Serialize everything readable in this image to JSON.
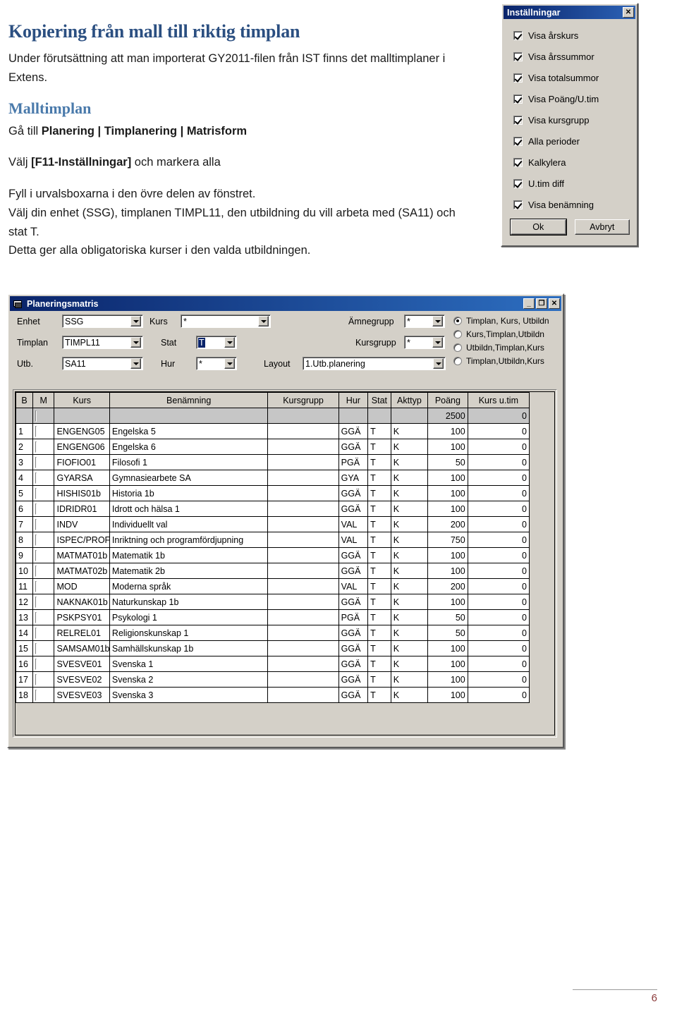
{
  "document": {
    "title": "Kopiering från mall till riktig timplan",
    "intro": "Under förutsättning att man importerat GY2011-filen från IST finns det malltimplaner i Extens.",
    "section_heading": "Malltimplan",
    "line_goto_prefix": "Gå till ",
    "line_goto_bold": "Planering | Timplanering | Matrisform",
    "line_select_prefix": "Välj ",
    "line_select_bold": "[F11-Inställningar]",
    "line_select_suffix": " och markera alla",
    "line_fill": "Fyll i urvalsboxarna i den övre delen av fönstret.",
    "line_choose": "Välj din enhet (SSG), timplanen TIMPL11, den utbildning du vill arbeta med (SA11) och stat T.",
    "line_result": "Detta ger alla obligatoriska kurser i den valda utbildningen.",
    "page_number": "6"
  },
  "settings_dialog": {
    "title": "Inställningar",
    "close_label": "✕",
    "checkboxes": [
      {
        "label": "Visa årskurs",
        "checked": true
      },
      {
        "label": "Visa årssummor",
        "checked": true
      },
      {
        "label": "Visa totalsummor",
        "checked": true
      },
      {
        "label": "Visa Poäng/U.tim",
        "checked": true
      },
      {
        "label": "Visa kursgrupp",
        "checked": true
      },
      {
        "label": "Alla perioder",
        "checked": true
      },
      {
        "label": "Kalkylera",
        "checked": true
      },
      {
        "label": "U.tim diff",
        "checked": true
      },
      {
        "label": "Visa benämning",
        "checked": true
      }
    ],
    "ok_label": "Ok",
    "cancel_label": "Avbryt"
  },
  "matrix_window": {
    "title": "Planeringsmatris",
    "minimize_label": "_",
    "maximize_label": "❐",
    "close_label": "✕",
    "fields": {
      "enhet_label": "Enhet",
      "enhet_value": "SSG",
      "timplan_label": "Timplan",
      "timplan_value": "TIMPL11",
      "utb_label": "Utb.",
      "utb_value": "SA11",
      "kurs_label": "Kurs",
      "kurs_value": "*",
      "stat_label": "Stat",
      "stat_value": "T",
      "hur_label": "Hur",
      "hur_value": "*",
      "amnegrupp_label": "Ämnegrupp",
      "amnegrupp_value": "*",
      "kursgrupp_label": "Kursgrupp",
      "kursgrupp_value": "*",
      "layout_label": "Layout",
      "layout_value": "1.Utb.planering"
    },
    "sort_options": [
      {
        "label": "Timplan, Kurs, Utbildn",
        "selected": true
      },
      {
        "label": "Kurs,Timplan,Utbildn",
        "selected": false
      },
      {
        "label": "Utbildn,Timplan,Kurs",
        "selected": false
      },
      {
        "label": "Timplan,Utbildn,Kurs",
        "selected": false
      }
    ],
    "grid": {
      "headers": [
        "B",
        "M",
        "Kurs",
        "Benämning",
        "Kursgrupp",
        "Hur",
        "Stat",
        "Akttyp",
        "Poäng",
        "Kurs u.tim"
      ],
      "total_row": {
        "poang": "2500",
        "kurs_utim": "0"
      },
      "rows": [
        {
          "n": "1",
          "kurs": "ENGENG05",
          "benamning": "Engelska 5",
          "kursgrupp": "",
          "hur": "GGÄ",
          "stat": "T",
          "akttyp": "K",
          "poang": "100",
          "kurs_utim": "0"
        },
        {
          "n": "2",
          "kurs": "ENGENG06",
          "benamning": "Engelska 6",
          "kursgrupp": "",
          "hur": "GGÄ",
          "stat": "T",
          "akttyp": "K",
          "poang": "100",
          "kurs_utim": "0"
        },
        {
          "n": "3",
          "kurs": "FIOFIO01",
          "benamning": "Filosofi 1",
          "kursgrupp": "",
          "hur": "PGÄ",
          "stat": "T",
          "akttyp": "K",
          "poang": "50",
          "kurs_utim": "0"
        },
        {
          "n": "4",
          "kurs": "GYARSA",
          "benamning": "Gymnasiearbete SA",
          "kursgrupp": "",
          "hur": "GYA",
          "stat": "T",
          "akttyp": "K",
          "poang": "100",
          "kurs_utim": "0"
        },
        {
          "n": "5",
          "kurs": "HISHIS01b",
          "benamning": "Historia 1b",
          "kursgrupp": "",
          "hur": "GGÄ",
          "stat": "T",
          "akttyp": "K",
          "poang": "100",
          "kurs_utim": "0"
        },
        {
          "n": "6",
          "kurs": "IDRIDR01",
          "benamning": "Idrott och hälsa 1",
          "kursgrupp": "",
          "hur": "GGÄ",
          "stat": "T",
          "akttyp": "K",
          "poang": "100",
          "kurs_utim": "0"
        },
        {
          "n": "7",
          "kurs": "INDV",
          "benamning": "Individuellt val",
          "kursgrupp": "",
          "hur": "VAL",
          "stat": "T",
          "akttyp": "K",
          "poang": "200",
          "kurs_utim": "0"
        },
        {
          "n": "8",
          "kurs": "ISPEC/PROF",
          "benamning": "Inriktning och programfördjupning",
          "kursgrupp": "",
          "hur": "VAL",
          "stat": "T",
          "akttyp": "K",
          "poang": "750",
          "kurs_utim": "0"
        },
        {
          "n": "9",
          "kurs": "MATMAT01b",
          "benamning": "Matematik 1b",
          "kursgrupp": "",
          "hur": "GGÄ",
          "stat": "T",
          "akttyp": "K",
          "poang": "100",
          "kurs_utim": "0"
        },
        {
          "n": "10",
          "kurs": "MATMAT02b",
          "benamning": "Matematik 2b",
          "kursgrupp": "",
          "hur": "GGÄ",
          "stat": "T",
          "akttyp": "K",
          "poang": "100",
          "kurs_utim": "0"
        },
        {
          "n": "11",
          "kurs": "MOD",
          "benamning": "Moderna språk",
          "kursgrupp": "",
          "hur": "VAL",
          "stat": "T",
          "akttyp": "K",
          "poang": "200",
          "kurs_utim": "0"
        },
        {
          "n": "12",
          "kurs": "NAKNAK01b",
          "benamning": "Naturkunskap 1b",
          "kursgrupp": "",
          "hur": "GGÄ",
          "stat": "T",
          "akttyp": "K",
          "poang": "100",
          "kurs_utim": "0"
        },
        {
          "n": "13",
          "kurs": "PSKPSY01",
          "benamning": "Psykologi 1",
          "kursgrupp": "",
          "hur": "PGÄ",
          "stat": "T",
          "akttyp": "K",
          "poang": "50",
          "kurs_utim": "0"
        },
        {
          "n": "14",
          "kurs": "RELREL01",
          "benamning": "Religionskunskap 1",
          "kursgrupp": "",
          "hur": "GGÄ",
          "stat": "T",
          "akttyp": "K",
          "poang": "50",
          "kurs_utim": "0"
        },
        {
          "n": "15",
          "kurs": "SAMSAM01b",
          "benamning": "Samhällskunskap 1b",
          "kursgrupp": "",
          "hur": "GGÄ",
          "stat": "T",
          "akttyp": "K",
          "poang": "100",
          "kurs_utim": "0"
        },
        {
          "n": "16",
          "kurs": "SVESVE01",
          "benamning": "Svenska 1",
          "kursgrupp": "",
          "hur": "GGÄ",
          "stat": "T",
          "akttyp": "K",
          "poang": "100",
          "kurs_utim": "0"
        },
        {
          "n": "17",
          "kurs": "SVESVE02",
          "benamning": "Svenska 2",
          "kursgrupp": "",
          "hur": "GGÄ",
          "stat": "T",
          "akttyp": "K",
          "poang": "100",
          "kurs_utim": "0"
        },
        {
          "n": "18",
          "kurs": "SVESVE03",
          "benamning": "Svenska 3",
          "kursgrupp": "",
          "hur": "GGÄ",
          "stat": "T",
          "akttyp": "K",
          "poang": "100",
          "kurs_utim": "0"
        }
      ]
    }
  },
  "colors": {
    "heading_primary": "#2b4f81",
    "heading_secondary": "#4a7aab",
    "window_face": "#d4d0c8",
    "titlebar_blue": "#0a246a",
    "page_number": "#8c3a3a"
  }
}
